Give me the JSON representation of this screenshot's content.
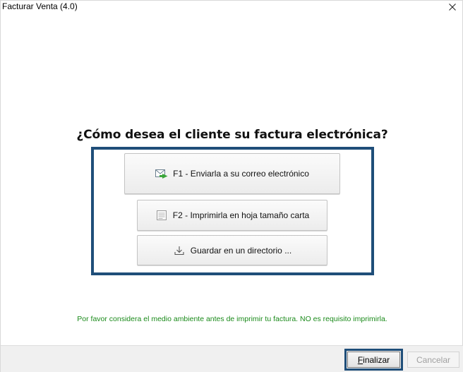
{
  "window": {
    "title": "Facturar Venta (4.0)"
  },
  "dialog": {
    "question": "¿Cómo desea el cliente su factura electrónica?",
    "options": [
      {
        "label": "F1 - Enviarla a su correo electrónico",
        "icon": "email-icon"
      },
      {
        "label": "F2 - Imprimirla en hoja tamaño carta",
        "icon": "document-icon"
      },
      {
        "label": "Guardar en un directorio ...",
        "icon": "download-icon"
      }
    ],
    "notice": "Por favor considera el medio ambiente antes de imprimir tu factura. NO es requisito imprimirla."
  },
  "footer": {
    "finalize_hotkey": "F",
    "finalize_rest": "inalizar",
    "cancel_label": "Cancelar"
  },
  "colors": {
    "highlight": "#1f4e79",
    "notice_text": "#1a8a1a",
    "disabled_text": "#a0a0a0"
  }
}
